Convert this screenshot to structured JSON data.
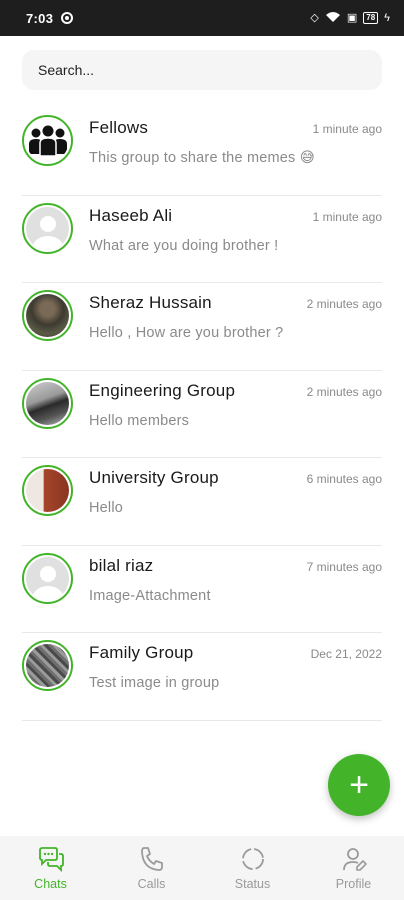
{
  "status_bar": {
    "time": "7:03",
    "battery": "78"
  },
  "search": {
    "placeholder": "Search..."
  },
  "chats": [
    {
      "name": "Fellows",
      "time": "1 minute ago",
      "message": "This group to share the memes 😅",
      "avatar": "group-icon"
    },
    {
      "name": "Haseeb Ali",
      "time": "1 minute ago",
      "message": "What are you doing brother !",
      "avatar": "default-user-icon"
    },
    {
      "name": "Sheraz Hussain",
      "time": "2 minutes ago",
      "message": "Hello , How are you brother ?",
      "avatar": "photo"
    },
    {
      "name": "Engineering Group",
      "time": "2 minutes ago",
      "message": "Hello members",
      "avatar": "photo"
    },
    {
      "name": "University Group",
      "time": "6 minutes ago",
      "message": "Hello",
      "avatar": "photo"
    },
    {
      "name": "bilal riaz",
      "time": "7 minutes ago",
      "message": "Image-Attachment",
      "avatar": "default-user-icon"
    },
    {
      "name": "Family Group",
      "time": "Dec 21, 2022",
      "message": "Test image in group",
      "avatar": "photo"
    }
  ],
  "fab": {
    "icon": "plus-icon"
  },
  "nav": {
    "chats": "Chats",
    "calls": "Calls",
    "status": "Status",
    "profile": "Profile"
  },
  "colors": {
    "accent": "#43b42a",
    "inactive": "#9a9a9a",
    "status_bar": "#1e1e1e"
  }
}
